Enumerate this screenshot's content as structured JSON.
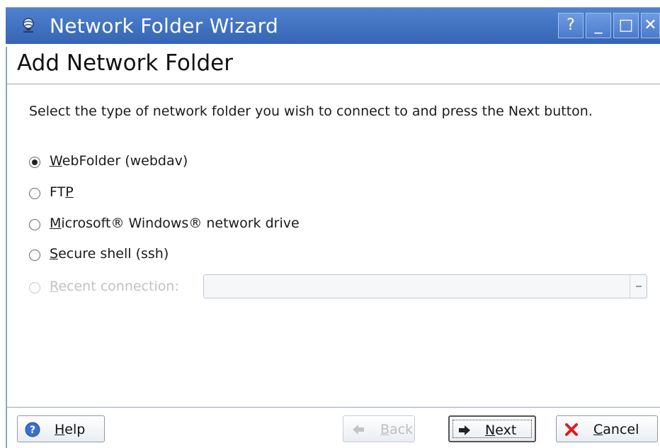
{
  "window": {
    "title": "Network Folder Wizard",
    "icon": "network-globe-icon",
    "buttons": [
      "?",
      "_",
      "□",
      "✕"
    ]
  },
  "page": {
    "title": "Add Network Folder",
    "instruction": "Select the type of network folder you wish to connect to and press the Next button."
  },
  "options": [
    {
      "label_pre": "",
      "label_mn": "W",
      "label_post": "ebFolder (webdav)",
      "checked": true,
      "enabled": true
    },
    {
      "label_pre": "FT",
      "label_mn": "P",
      "label_post": "",
      "checked": false,
      "enabled": true
    },
    {
      "label_pre": "",
      "label_mn": "M",
      "label_post": "icrosoft® Windows® network drive",
      "checked": false,
      "enabled": true
    },
    {
      "label_pre": "",
      "label_mn": "S",
      "label_post": "ecure shell (ssh)",
      "checked": false,
      "enabled": true
    },
    {
      "label_pre": "",
      "label_mn": "R",
      "label_post": "ecent connection:",
      "checked": false,
      "enabled": false
    }
  ],
  "recent_combo": {
    "value": ""
  },
  "buttons": {
    "help": {
      "mn": "H",
      "rest": "elp"
    },
    "back": {
      "mn": "B",
      "rest": "ack"
    },
    "next": {
      "mn": "N",
      "rest": "ext"
    },
    "cancel": {
      "mn": "C",
      "rest": "ancel"
    }
  },
  "colors": {
    "titlebar": "#3f72c2",
    "help_icon": "#3a6fd0",
    "cancel_icon": "#d62020"
  }
}
